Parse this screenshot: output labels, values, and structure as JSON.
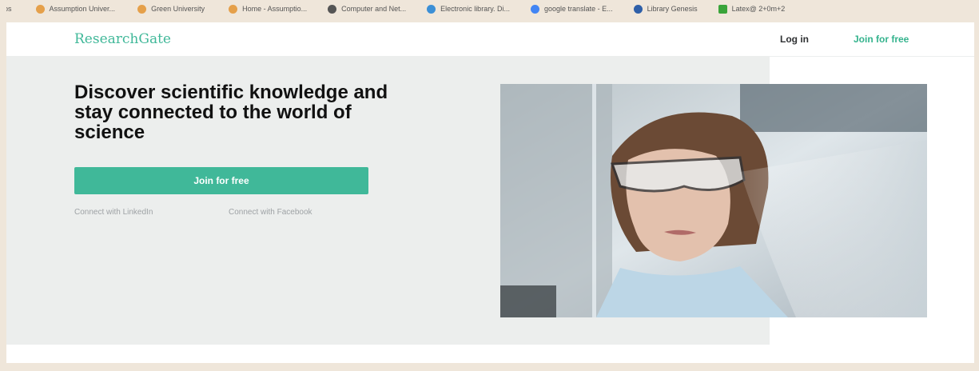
{
  "browser": {
    "bookmarks": [
      {
        "label": "pps",
        "color": "#efe6da"
      },
      {
        "label": "Assumption Univer...",
        "color": "#e5a04a"
      },
      {
        "label": "Green University",
        "color": "#e5a04a"
      },
      {
        "label": "Home - Assumptio...",
        "color": "#e5a04a"
      },
      {
        "label": "Computer and Net...",
        "color": "#555555"
      },
      {
        "label": "Electronic library. Di...",
        "color": "#3b8fd6"
      },
      {
        "label": "google translate - E...",
        "color": "#4285f4"
      },
      {
        "label": "Library Genesis",
        "color": "#2e5fa8"
      },
      {
        "label": "Latex@ 2+0m+2",
        "color": "#3aa43a"
      }
    ]
  },
  "header": {
    "logo": "ResearchGate",
    "login_label": "Log in",
    "join_label": "Join for free"
  },
  "hero": {
    "headline": "Discover scientific knowledge and stay connected to the world of science",
    "cta_label": "Join for free",
    "linkedin_label": "Connect with LinkedIn",
    "facebook_label": "Connect with Facebook"
  },
  "colors": {
    "brand": "#40b899",
    "hero_bg": "#eceeed",
    "frame": "#efe6da"
  }
}
